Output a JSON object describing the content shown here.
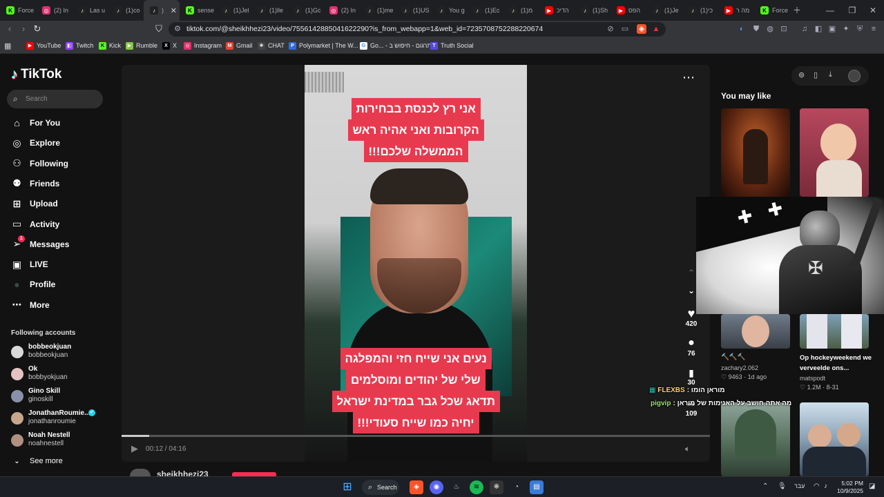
{
  "browser": {
    "tabs": [
      {
        "title": "Force",
        "icon": "kick-icon",
        "color": "#53fc18"
      },
      {
        "title": "(2) In",
        "icon": "instagram-icon",
        "color": "#e1306c"
      },
      {
        "title": "Las u",
        "icon": "tiktok-icon",
        "color": "#222"
      },
      {
        "title": "(1)co",
        "icon": "tiktok-icon",
        "color": "#222"
      },
      {
        "title": ")",
        "icon": "tiktok-icon",
        "color": "#222",
        "active": true
      },
      {
        "title": "sense",
        "icon": "kick-icon",
        "color": "#53fc18"
      },
      {
        "title": "(1)Jel",
        "icon": "tiktok-icon",
        "color": "#222"
      },
      {
        "title": "(1)lle",
        "icon": "tiktok-icon",
        "color": "#222"
      },
      {
        "title": "(1)Gc",
        "icon": "tiktok-icon",
        "color": "#222"
      },
      {
        "title": "(2) In",
        "icon": "instagram-icon",
        "color": "#e1306c"
      },
      {
        "title": "(1)me",
        "icon": "tiktok-icon",
        "color": "#222"
      },
      {
        "title": "(1)US",
        "icon": "tiktok-icon",
        "color": "#222"
      },
      {
        "title": "You g",
        "icon": "tiktok-icon",
        "color": "#222"
      },
      {
        "title": "(1)Ec",
        "icon": "tiktok-icon",
        "color": "#222"
      },
      {
        "title": "(1)מ",
        "icon": "tiktok-icon",
        "color": "#222"
      },
      {
        "title": "הדיכ",
        "icon": "youtube-icon",
        "color": "#ff0000"
      },
      {
        "title": "(1)Sh",
        "icon": "tiktok-icon",
        "color": "#222"
      },
      {
        "title": "הפס",
        "icon": "youtube-icon",
        "color": "#ff0000"
      },
      {
        "title": "(1)Je",
        "icon": "tiktok-icon",
        "color": "#222"
      },
      {
        "title": "(1)כי",
        "icon": "tiktok-icon",
        "color": "#222"
      },
      {
        "title": "מה ר",
        "icon": "youtube-icon",
        "color": "#ff0000"
      },
      {
        "title": "Force",
        "icon": "kick-icon",
        "color": "#53fc18"
      }
    ],
    "url": "tiktok.com/@sheikhhezi23/video/7556142885041622290?is_from_webapp=1&web_id=7235708752288220674",
    "bookmarks": [
      {
        "label": "YouTube",
        "icon": "youtube-icon",
        "color": "#ff0000"
      },
      {
        "label": "Twitch",
        "icon": "twitch-icon",
        "color": "#9146ff"
      },
      {
        "label": "Kick",
        "icon": "kick-icon",
        "color": "#53fc18"
      },
      {
        "label": "Rumble",
        "icon": "rumble-icon",
        "color": "#85c742"
      },
      {
        "label": "X",
        "icon": "x-icon",
        "color": "#000000"
      },
      {
        "label": "Instagram",
        "icon": "instagram-icon",
        "color": "#e1306c"
      },
      {
        "label": "Gmail",
        "icon": "gmail-icon",
        "color": "#ea4335"
      },
      {
        "label": "CHAT",
        "icon": "chatgpt-icon",
        "color": "#444"
      },
      {
        "label": "Polymarket | The W...",
        "icon": "polymarket-icon",
        "color": "#2d6cdf"
      },
      {
        "label": "Go... - תרגום - חיפוש ב",
        "icon": "google-icon",
        "color": "#ffffff"
      },
      {
        "label": "Truth Social",
        "icon": "truth-social-icon",
        "color": "#5448ee"
      }
    ]
  },
  "sidebar": {
    "logo": "TikTok",
    "search_placeholder": "Search",
    "nav": [
      {
        "label": "For You",
        "icon": "home-icon"
      },
      {
        "label": "Explore",
        "icon": "compass-icon"
      },
      {
        "label": "Following",
        "icon": "following-icon"
      },
      {
        "label": "Friends",
        "icon": "friends-icon"
      },
      {
        "label": "Upload",
        "icon": "upload-icon"
      },
      {
        "label": "Activity",
        "icon": "activity-icon"
      },
      {
        "label": "Messages",
        "icon": "messages-icon",
        "badge": "1"
      },
      {
        "label": "LIVE",
        "icon": "live-icon"
      },
      {
        "label": "Profile",
        "icon": "profile-icon"
      },
      {
        "label": "More",
        "icon": "more-icon"
      }
    ],
    "following_title": "Following accounts",
    "accounts": [
      {
        "name": "bobbeokjuan",
        "handle": "bobbeokjuan"
      },
      {
        "name": "Ok",
        "handle": "bobbyokjuan"
      },
      {
        "name": "Gino Skill",
        "handle": "ginoskill"
      },
      {
        "name": "JonathanRoumie...",
        "handle": "jonathanroumie",
        "verified": true
      },
      {
        "name": "Noah Nestell",
        "handle": "noahnestell"
      }
    ],
    "see_more": "See more"
  },
  "video": {
    "caption_top": [
      "אני רץ לכנסת בבחירות",
      "הקרובות ואני אהיה ראש",
      "הממשלה שלכם!!!"
    ],
    "caption_bottom": [
      "נעים אני שייח חזי והמפלגה",
      "שלי של יהודים ומוסלמים",
      "תדאג שכל גבר במדינת ישראל",
      "יחיה כמו שייח סעודי!!!"
    ],
    "time": "00:12 / 04:16",
    "progress": 0.047,
    "author": "sheikhhezi23"
  },
  "actions": {
    "likes": "420",
    "comments": "76",
    "saves": "30",
    "shares": "109"
  },
  "overlay_chat": [
    {
      "user": "FLEXBS",
      "text": ": מוראן הומו"
    },
    {
      "user": "pigvip",
      "text": ": מה אתה חושב על האנימות של מוראן"
    }
  ],
  "you_may_like": {
    "title": "You may like",
    "items": [
      {
        "caption": "🔨🔨🔨",
        "author": "zachary2.062",
        "stats": "9463 · 1d ago"
      },
      {
        "caption": "Op hockeyweekend we verveelde ons...",
        "author": "matspodt",
        "stats": "1.2M · 8-31"
      }
    ]
  },
  "taskbar": {
    "search_label": "Search",
    "lang": "עבר",
    "time": "5:02 PM",
    "date": "10/9/2025"
  }
}
